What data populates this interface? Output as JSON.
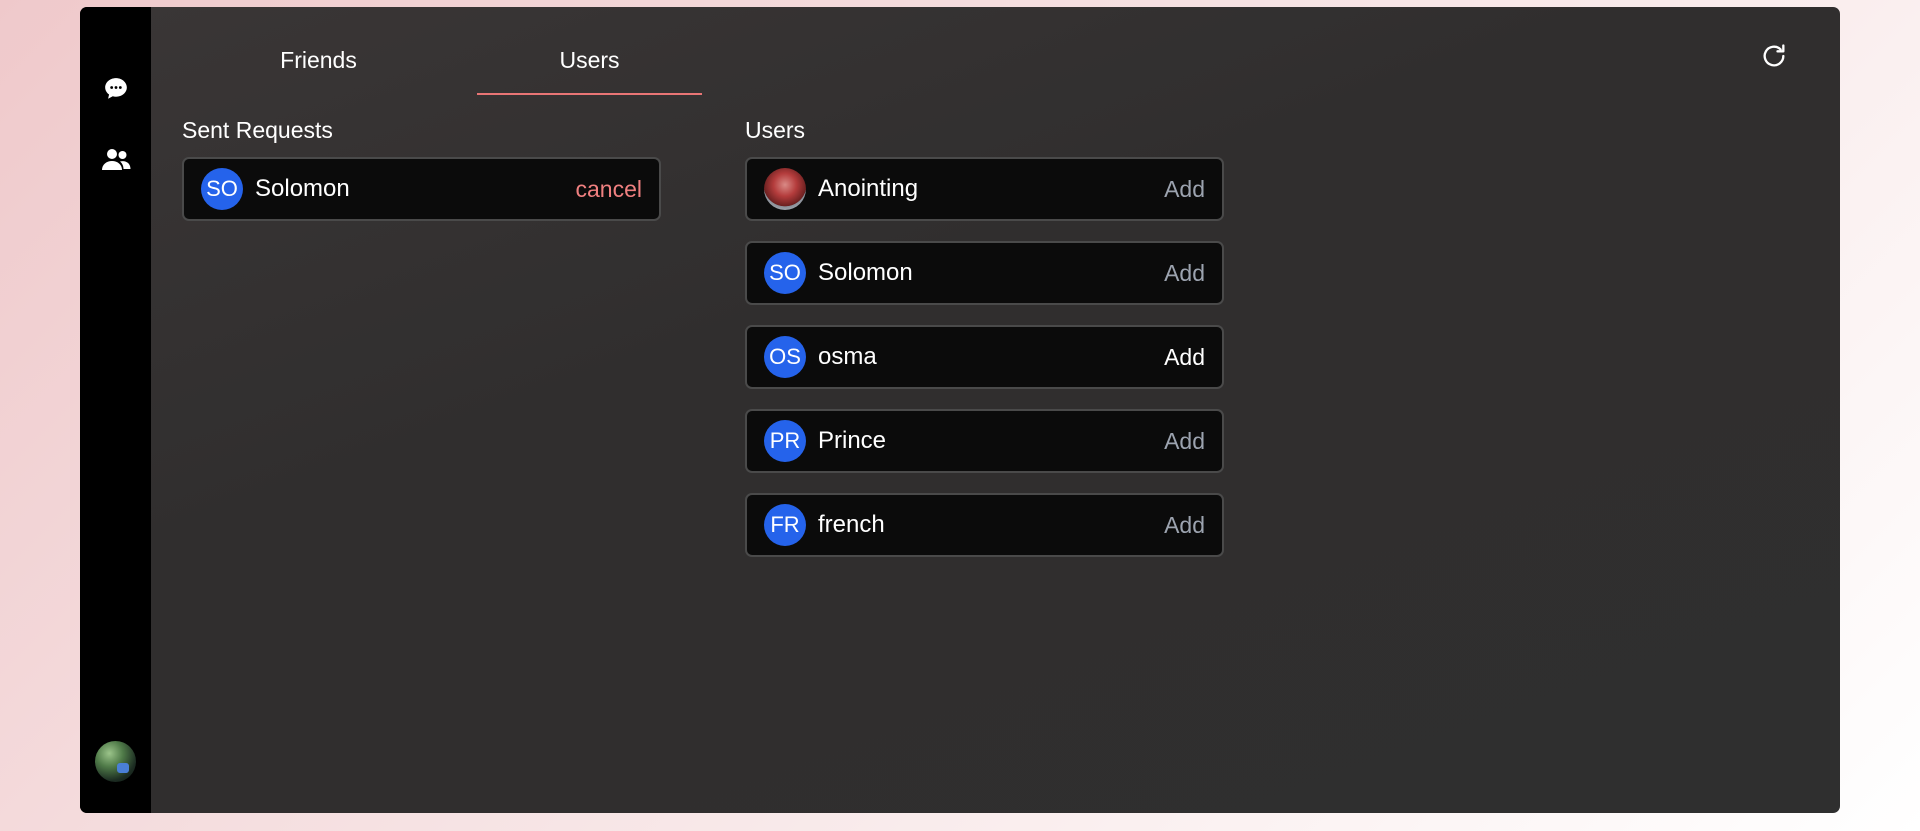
{
  "sidebar": {
    "items": [
      {
        "icon": "chat-bubble-icon"
      },
      {
        "icon": "users-icon"
      }
    ],
    "profile_avatar": "profile-photo"
  },
  "tabs": [
    {
      "label": "Friends",
      "active": false
    },
    {
      "label": "Users",
      "active": true
    }
  ],
  "toolbar": {
    "refresh_icon": "refresh-icon"
  },
  "sent_requests": {
    "title": "Sent Requests",
    "items": [
      {
        "initials": "SO",
        "name": "Solomon",
        "action": "cancel"
      }
    ]
  },
  "users": {
    "title": "Users",
    "items": [
      {
        "initials": "",
        "photo": true,
        "name": "Anointing",
        "action": "Add"
      },
      {
        "initials": "SO",
        "name": "Solomon",
        "action": "Add"
      },
      {
        "initials": "OS",
        "name": "osma",
        "action": "Add",
        "highlighted": true
      },
      {
        "initials": "PR",
        "name": "Prince",
        "action": "Add"
      },
      {
        "initials": "FR",
        "name": "french",
        "action": "Add"
      }
    ]
  },
  "colors": {
    "accent": "#e97575",
    "avatar_bg": "#2563eb",
    "card_bg": "#0b0b0b",
    "add_muted": "#9ca3af"
  }
}
